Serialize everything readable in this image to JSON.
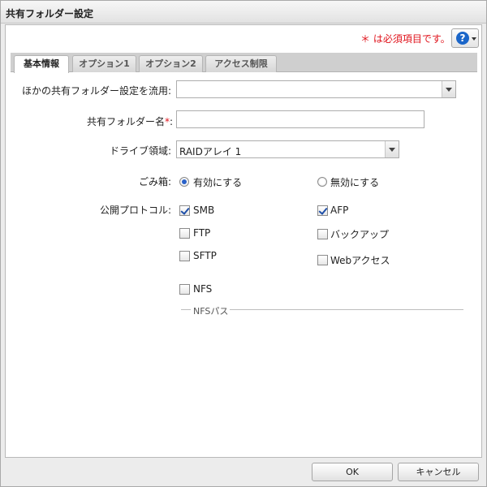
{
  "window": {
    "title": "共有フォルダー設定"
  },
  "header": {
    "required_note": "＊ は必須項目です。",
    "help_glyph": "?",
    "help_icon": "help-circle-icon"
  },
  "tabs": [
    {
      "label": "基本情報",
      "active": true
    },
    {
      "label": "オプション1",
      "active": false
    },
    {
      "label": "オプション2",
      "active": false
    },
    {
      "label": "アクセス制限",
      "active": false
    }
  ],
  "form": {
    "copy_from": {
      "label": "ほかの共有フォルダー設定を流用:",
      "value": ""
    },
    "folder_name": {
      "label": "共有フォルダー名",
      "required_mark": "*",
      "label_suffix": ":",
      "value": ""
    },
    "drive_area": {
      "label": "ドライブ領域:",
      "value": "RAIDアレイ 1"
    },
    "recycle_bin": {
      "label": "ごみ箱:",
      "options": [
        {
          "label": "有効にする",
          "selected": true
        },
        {
          "label": "無効にする",
          "selected": false
        }
      ]
    },
    "protocols": {
      "label": "公開プロトコル:",
      "items": [
        {
          "label": "SMB",
          "checked": true
        },
        {
          "label": "AFP",
          "checked": true
        },
        {
          "label": "FTP",
          "checked": false
        },
        {
          "label": "バックアップ",
          "checked": false
        },
        {
          "label": "SFTP",
          "checked": false
        },
        {
          "label": "Webアクセス",
          "checked": false
        },
        {
          "label": "NFS",
          "checked": false
        }
      ]
    },
    "nfs_path": {
      "legend": "NFSパス"
    }
  },
  "footer": {
    "ok_label": "OK",
    "cancel_label": "キャンセル"
  }
}
